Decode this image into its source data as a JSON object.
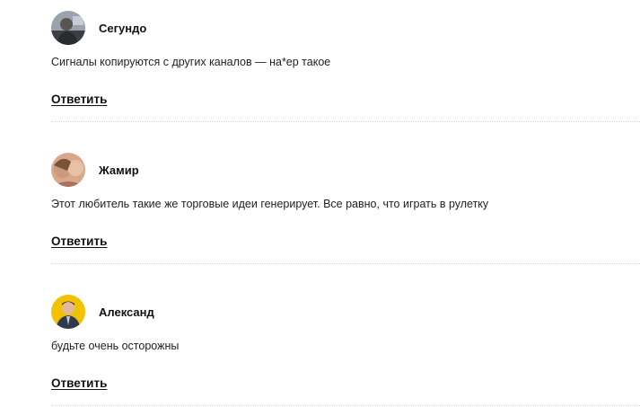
{
  "comments": [
    {
      "author": "Сегундо",
      "text": "Сигналы копируются с других каналов — на*ер такое",
      "reply_label": "Ответить",
      "avatar_icon": "user-photo-avatar"
    },
    {
      "author": "Жамир",
      "text": "Этот любитель такие же торговые идеи генерирует. Все равно, что играть в рулетку",
      "reply_label": "Ответить",
      "avatar_icon": "user-photo-avatar"
    },
    {
      "author": "Александ",
      "text": "будьте очень осторожны",
      "reply_label": "Ответить",
      "avatar_icon": "user-photo-avatar"
    }
  ]
}
